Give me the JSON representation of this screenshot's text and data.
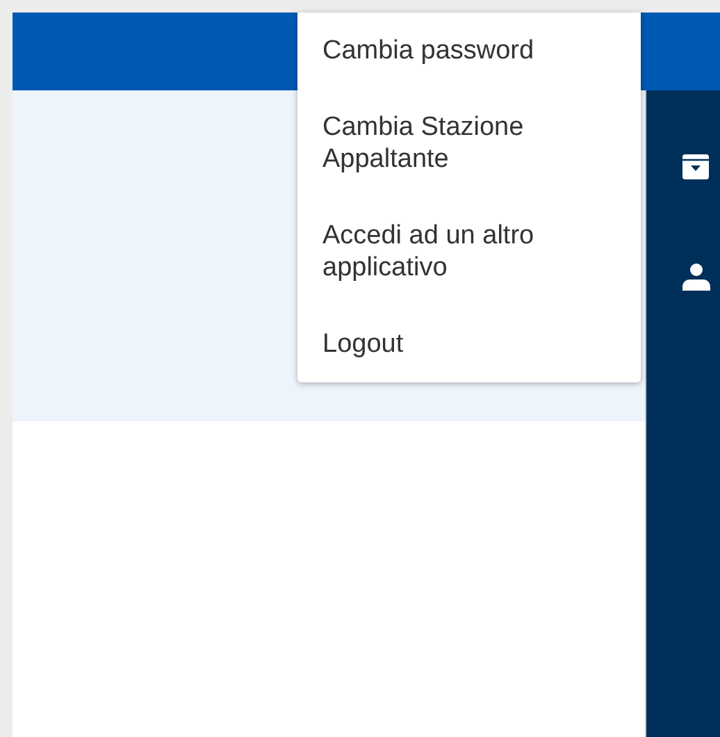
{
  "user_menu": {
    "items": [
      {
        "label": "Cambia password"
      },
      {
        "label": "Cambia Stazione Appaltante"
      },
      {
        "label": "Accedi ad un altro applicativo"
      },
      {
        "label": "Logout"
      }
    ]
  }
}
